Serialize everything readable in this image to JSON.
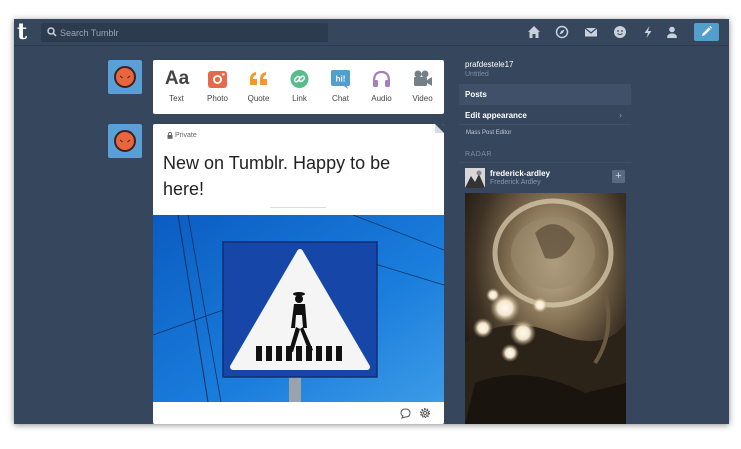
{
  "topbar": {
    "logo": "t",
    "search_placeholder": "Search Tumblr",
    "nav_icons": [
      "home-icon",
      "explore-icon",
      "inbox-icon",
      "messages-icon",
      "activity-icon",
      "account-icon"
    ],
    "compose_icon": "pencil-icon"
  },
  "post_types": [
    {
      "label": "Text",
      "icon": "text-icon",
      "color": "#444444"
    },
    {
      "label": "Photo",
      "icon": "camera-icon",
      "color": "#e46a4a"
    },
    {
      "label": "Quote",
      "icon": "quote-icon",
      "color": "#f2992e"
    },
    {
      "label": "Link",
      "icon": "link-icon",
      "color": "#56bc8a"
    },
    {
      "label": "Chat",
      "icon": "chat-icon",
      "color": "#529ecc"
    },
    {
      "label": "Audio",
      "icon": "headphones-icon",
      "color": "#a77dc2"
    },
    {
      "label": "Video",
      "icon": "video-camera-icon",
      "color": "#748089"
    }
  ],
  "post": {
    "privacy": "Private",
    "title": "New on Tumblr. Happy to be here!",
    "image": "pedestrian-crossing-sign-photo",
    "footer_icons": [
      "comment-icon",
      "settings-icon"
    ]
  },
  "sidebar": {
    "blog_name": "prafdestele17",
    "blog_title": "Untitled",
    "menu": [
      {
        "label": "Posts",
        "active": true
      },
      {
        "label": "Edit appearance",
        "active": false
      }
    ],
    "mass_post_editor": "Mass Post Editor",
    "radar": {
      "header": "RADAR",
      "user": "frederick-ardley",
      "title": "Frederick Ardley",
      "follow": "+"
    }
  },
  "colors": {
    "background": "#36465d",
    "accent": "#529ecc",
    "avatar_bg": "#5aa0d6"
  }
}
